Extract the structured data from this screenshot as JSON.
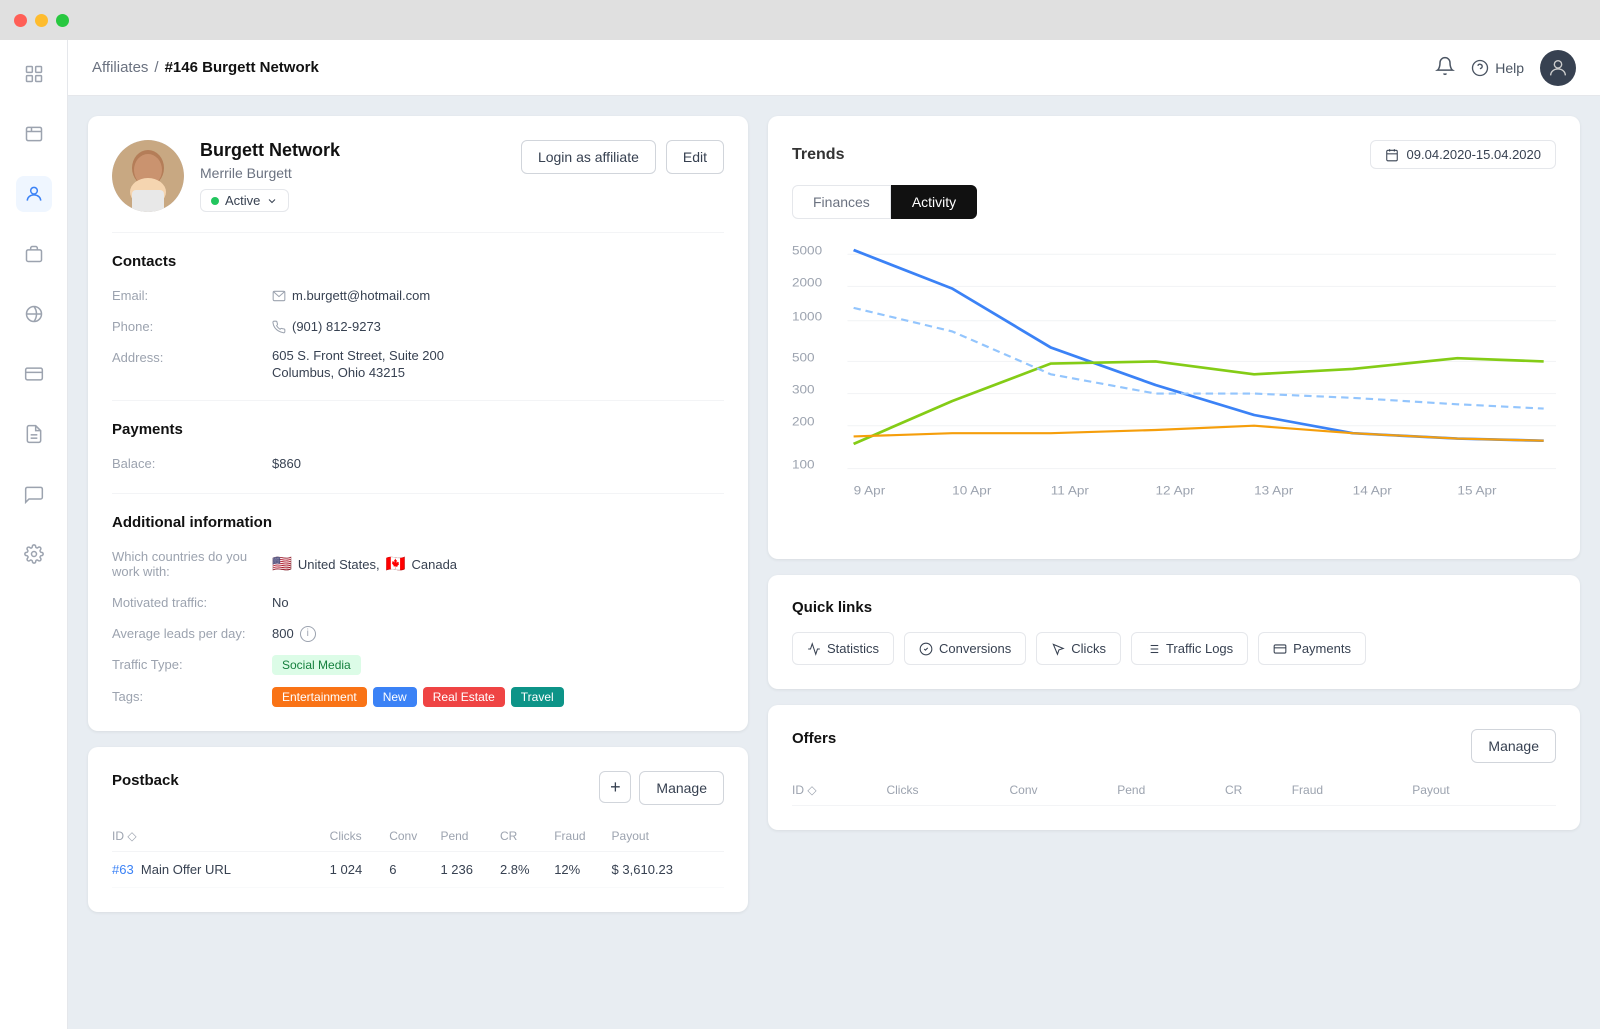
{
  "titlebar": {
    "dots": [
      "red",
      "yellow",
      "green"
    ]
  },
  "sidebar": {
    "icons": [
      {
        "name": "chart-icon",
        "label": "Dashboard",
        "active": false
      },
      {
        "name": "contacts-icon",
        "label": "Contacts",
        "active": false
      },
      {
        "name": "affiliates-icon",
        "label": "Affiliates",
        "active": true
      },
      {
        "name": "briefcase-icon",
        "label": "Offers",
        "active": false
      },
      {
        "name": "globe-icon",
        "label": "Network",
        "active": false
      },
      {
        "name": "card-icon",
        "label": "Payments",
        "active": false
      },
      {
        "name": "reports-icon",
        "label": "Reports",
        "active": false
      },
      {
        "name": "mail-icon",
        "label": "Messages",
        "active": false
      },
      {
        "name": "settings-icon",
        "label": "Settings",
        "active": false
      }
    ]
  },
  "topbar": {
    "breadcrumb_parent": "Affiliates",
    "breadcrumb_separator": "/",
    "breadcrumb_current": "#146 Burgett Network",
    "help_label": "Help",
    "bell_label": "Notifications"
  },
  "profile": {
    "name": "Burgett Network",
    "subname": "Merrile Burgett",
    "status": "Active",
    "login_button": "Login as affiliate",
    "edit_button": "Edit",
    "contacts": {
      "section_title": "Contacts",
      "email_label": "Email:",
      "email_value": "m.burgett@hotmail.com",
      "phone_label": "Phone:",
      "phone_value": "(901) 812-9273",
      "address_label": "Address:",
      "address_line1": "605 S. Front Street, Suite 200",
      "address_line2": "Columbus, Ohio 43215"
    },
    "payments": {
      "section_title": "Payments",
      "balance_label": "Balace:",
      "balance_value": "$860"
    },
    "additional": {
      "section_title": "Additional information",
      "countries_label": "Which countries do you work with:",
      "countries": [
        {
          "flag": "🇺🇸",
          "name": "United States"
        },
        {
          "flag": "🇨🇦",
          "name": "Canada"
        }
      ],
      "motivated_label": "Motivated traffic:",
      "motivated_value": "No",
      "avg_leads_label": "Average leads per day:",
      "avg_leads_value": "800",
      "traffic_type_label": "Traffic Type:",
      "traffic_type_value": "Social Media",
      "tags_label": "Tags:",
      "tags": [
        {
          "label": "Entertainment",
          "color": "orange"
        },
        {
          "label": "New",
          "color": "blue"
        },
        {
          "label": "Real Estate",
          "color": "red"
        },
        {
          "label": "Travel",
          "color": "teal"
        }
      ]
    }
  },
  "postback": {
    "section_title": "Postback",
    "add_button": "+",
    "manage_button": "Manage",
    "table_headers": [
      "ID",
      "Clicks",
      "Conv",
      "Pend",
      "CR",
      "Fraud",
      "Payout"
    ],
    "rows": [
      {
        "id": "#63",
        "id_label": "Main Offer URL",
        "clicks": "1 024",
        "conv": "6",
        "pend": "1 236",
        "cr": "2.8%",
        "fraud": "12%",
        "payout": "$ 3,610.23"
      }
    ]
  },
  "trends": {
    "title": "Trends",
    "date_range": "09.04.2020-15.04.2020",
    "tabs": [
      {
        "label": "Finances",
        "active": false
      },
      {
        "label": "Activity",
        "active": true
      }
    ],
    "chart": {
      "y_labels": [
        "5000",
        "2000",
        "1000",
        "500",
        "300",
        "200",
        "100"
      ],
      "x_labels": [
        "9 Apr",
        "10 Apr",
        "11 Apr",
        "12 Apr",
        "13 Apr",
        "14 Apr",
        "15 Apr"
      ],
      "series": [
        {
          "name": "blue-solid",
          "color": "#3b82f6"
        },
        {
          "name": "green-solid",
          "color": "#84cc16"
        },
        {
          "name": "orange-solid",
          "color": "#f59e0b"
        },
        {
          "name": "blue-dashed",
          "color": "#93c5fd"
        }
      ]
    }
  },
  "quick_links": {
    "title": "Quick links",
    "links": [
      {
        "label": "Statistics",
        "icon": "chart-link-icon"
      },
      {
        "label": "Conversions",
        "icon": "check-circle-icon"
      },
      {
        "label": "Clicks",
        "icon": "cursor-icon"
      },
      {
        "label": "Traffic Logs",
        "icon": "list-icon"
      },
      {
        "label": "Payments",
        "icon": "card-link-icon"
      }
    ]
  },
  "offers": {
    "title": "Offers",
    "manage_button": "Manage",
    "table_headers": [
      "ID",
      "Clicks",
      "Conv",
      "Pend",
      "CR",
      "Fraud",
      "Payout"
    ]
  }
}
